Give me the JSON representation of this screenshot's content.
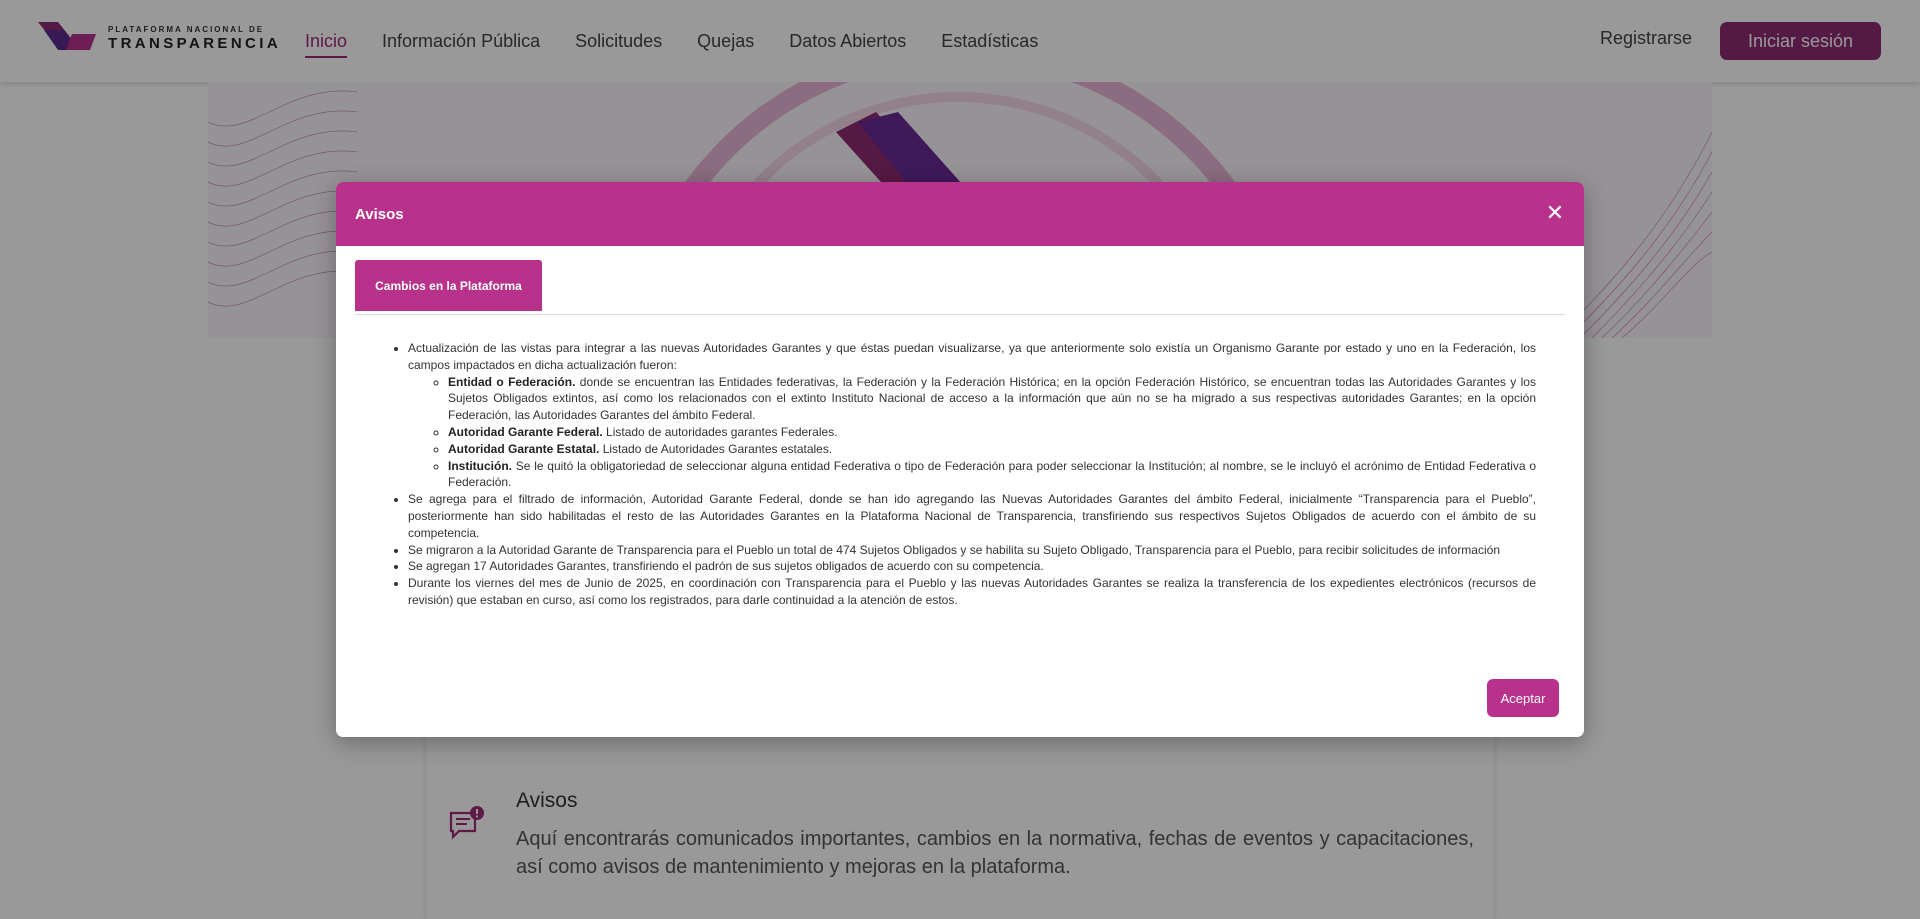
{
  "brand": {
    "logo_top": "PLATAFORMA NACIONAL DE",
    "logo_bottom": "TRANSPARENCIA",
    "primary_color": "#b8328c",
    "dark_color": "#8e2a73"
  },
  "nav": {
    "items": [
      {
        "label": "Inicio",
        "active": true
      },
      {
        "label": "Información Pública"
      },
      {
        "label": "Solicitudes"
      },
      {
        "label": "Quejas"
      },
      {
        "label": "Datos Abiertos"
      },
      {
        "label": "Estadísticas"
      }
    ],
    "register_label": "Registrarse",
    "login_label": "Iniciar sesión"
  },
  "avisos_card": {
    "icon": "message-alert-icon",
    "title": "Avisos",
    "text": "Aquí encontrarás comunicados importantes, cambios en la normativa, fechas de eventos y capacitaciones, así como avisos de mantenimiento y mejoras en la plataforma."
  },
  "modal": {
    "title": "Avisos",
    "close_icon": "close-icon",
    "tab_label": "Cambios en la Plataforma",
    "accept_label": "Aceptar",
    "items": {
      "i1": "Actualización de las vistas para integrar a las nuevas Autoridades Garantes y que éstas puedan visualizarse, ya que anteriormente solo existía un Organismo Garante por estado y uno en la Federación, los campos impactados en dicha actualización fueron:",
      "s1_title": "Entidad o Federación.",
      "s1_text": " donde se encuentran las Entidades federativas, la Federación y la Federación Histórica; en la opción Federación Histórico, se encuentran todas las Autoridades Garantes y los Sujetos Obligados extintos, así como los relacionados con el extinto Instituto Nacional de acceso a la información que aún no se ha migrado a sus respectivas autoridades Garantes; en la opción Federación, las Autoridades Garantes del ámbito Federal.",
      "s2_title": "Autoridad Garante Federal.",
      "s2_text": " Listado de autoridades garantes Federales.",
      "s3_title": "Autoridad Garante Estatal.",
      "s3_text": " Listado de Autoridades Garantes estatales.",
      "s4_title": "Institución.",
      "s4_text": " Se le quitó la obligatoriedad de seleccionar alguna entidad Federativa o tipo de Federación para poder seleccionar la Institución; al nombre, se le incluyó el acrónimo de Entidad Federativa o Federación.",
      "i2": "Se agrega para el filtrado de información, Autoridad Garante Federal, donde se han ido agregando las Nuevas Autoridades Garantes del ámbito Federal, inicialmente “Transparencia para el Pueblo”, posteriormente han sido habilitadas el resto de las Autoridades Garantes en la Plataforma Nacional de Transparencia, transfiriendo sus respectivos Sujetos Obligados de acuerdo con el ámbito de su competencia.",
      "i3": "Se migraron a la Autoridad Garante de Transparencia para el Pueblo un total de 474 Sujetos Obligados y se habilita su Sujeto Obligado, Transparencia para el Pueblo, para recibir solicitudes de información",
      "i4": "Se agregan 17 Autoridades Garantes, transfiriendo el padrón de sus sujetos obligados de acuerdo con su competencia.",
      "i5": "Durante los viernes del mes de Junio de 2025, en coordinación con Transparencia para el Pueblo y las nuevas Autoridades Garantes se realiza la transferencia de los expedientes electrónicos (recursos de revisión) que estaban en curso, así como los registrados, para darle continuidad a la atención de estos."
    }
  }
}
